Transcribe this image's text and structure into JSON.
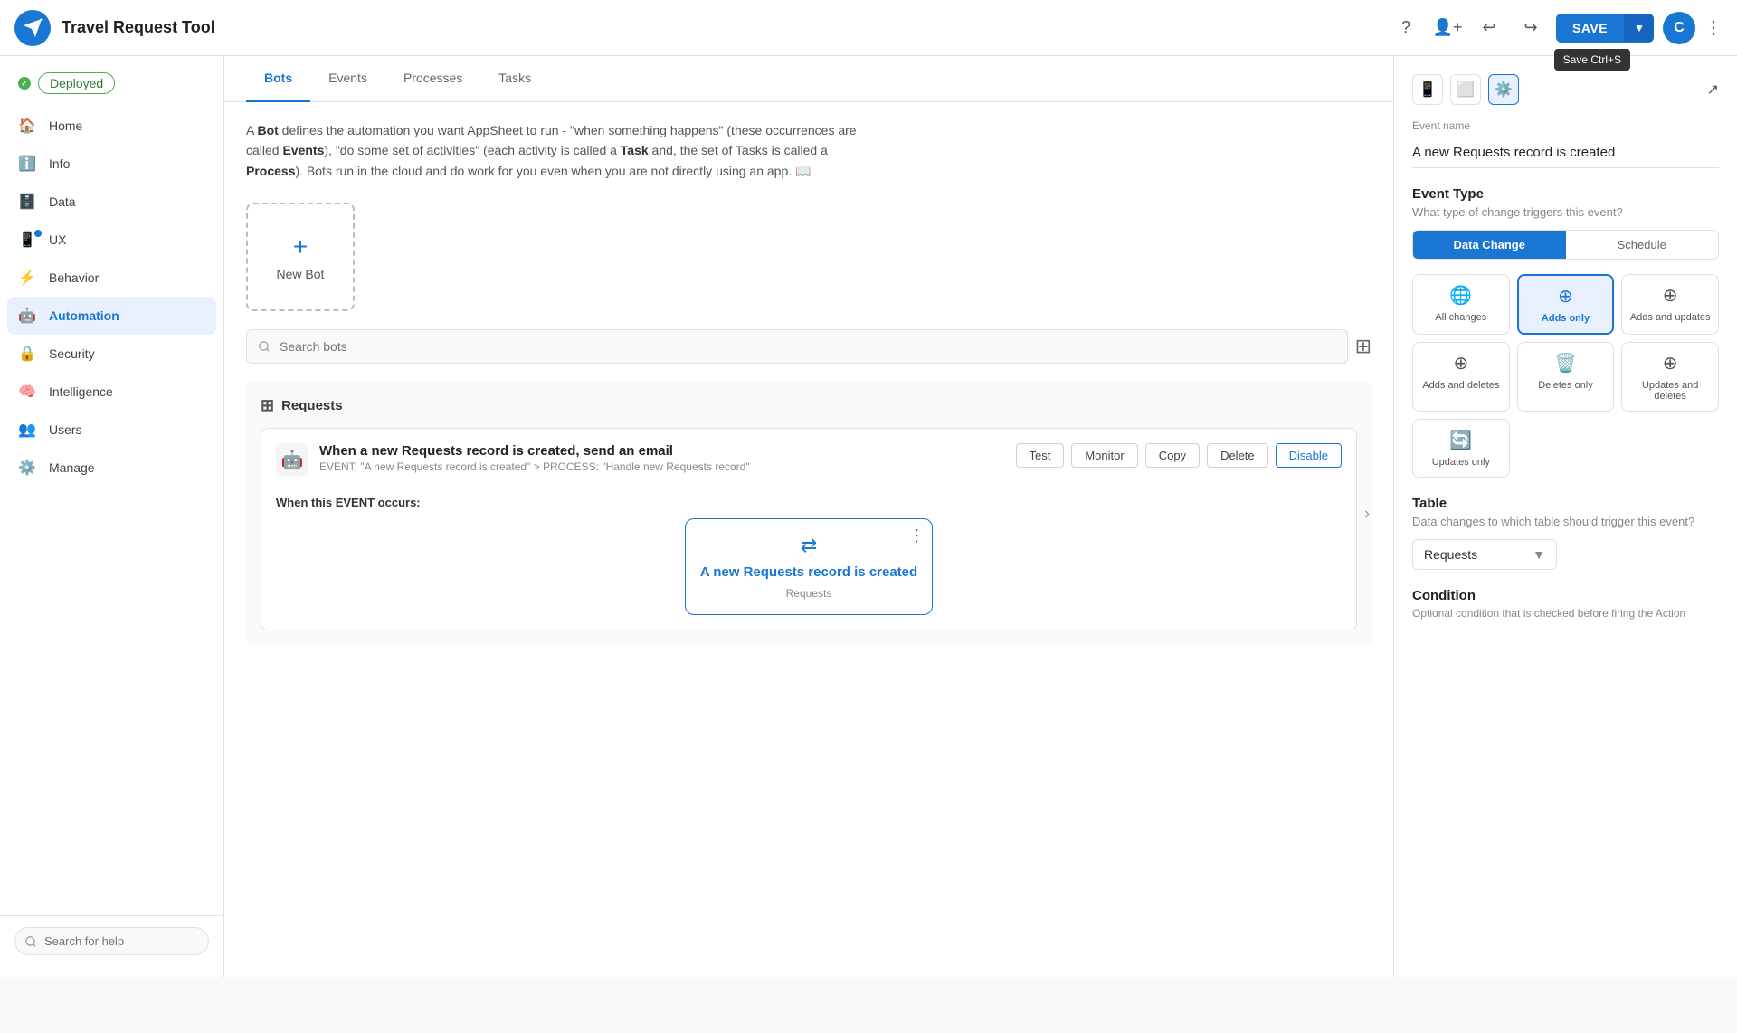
{
  "app": {
    "title": "Travel Request Tool",
    "save_label": "SAVE",
    "save_shortcut": "Save Ctrl+S"
  },
  "topbar": {
    "avatar_letter": "C"
  },
  "sidebar": {
    "status": "Deployed",
    "items": [
      {
        "id": "home",
        "label": "Home",
        "icon": "🏠"
      },
      {
        "id": "info",
        "label": "Info",
        "icon": "ℹ"
      },
      {
        "id": "data",
        "label": "Data",
        "icon": "🗄"
      },
      {
        "id": "ux",
        "label": "UX",
        "icon": "📱",
        "dot": true
      },
      {
        "id": "behavior",
        "label": "Behavior",
        "icon": "⚡"
      },
      {
        "id": "automation",
        "label": "Automation",
        "icon": "🤖",
        "active": true
      },
      {
        "id": "security",
        "label": "Security",
        "icon": "🔒"
      },
      {
        "id": "intelligence",
        "label": "Intelligence",
        "icon": "🧠"
      },
      {
        "id": "users",
        "label": "Users",
        "icon": "👥"
      },
      {
        "id": "manage",
        "label": "Manage",
        "icon": "⚙"
      }
    ],
    "search_placeholder": "Search for help"
  },
  "tabs": [
    {
      "id": "bots",
      "label": "Bots",
      "active": true
    },
    {
      "id": "events",
      "label": "Events"
    },
    {
      "id": "processes",
      "label": "Processes"
    },
    {
      "id": "tasks",
      "label": "Tasks"
    }
  ],
  "description": "A Bot defines the automation you want AppSheet to run - \"when something happens\" (these occurrences are called Events), \"do some set of activities\" (each activity is called a Task and, the set of Tasks is called a Process). Bots run in the cloud and do work for you even when you are not directly using an app.",
  "new_bot_label": "New Bot",
  "search_bots_placeholder": "Search bots",
  "bot_section": {
    "title": "Requests",
    "bot": {
      "title": "When a new Requests record is created, send an email",
      "event_desc": "EVENT: \"A new Requests record is created\" > PROCESS: \"Handle new Requests record\"",
      "actions": [
        "Test",
        "Monitor",
        "Copy",
        "Delete",
        "Disable"
      ],
      "event_label": "When this EVENT occurs:",
      "event_card": {
        "title": "A new Requests record is created",
        "subtitle": "Requests"
      }
    }
  },
  "right_panel": {
    "event_name_label": "Event name",
    "event_name_value": "A new Requests record is created",
    "event_type_title": "Event Type",
    "event_type_subtitle": "What type of change triggers this event?",
    "event_type_tabs": [
      {
        "id": "data_change",
        "label": "Data Change",
        "active": true
      },
      {
        "id": "schedule",
        "label": "Schedule"
      }
    ],
    "change_types": [
      {
        "id": "all_changes",
        "label": "All changes",
        "icon": "🌐"
      },
      {
        "id": "adds_only",
        "label": "Adds only",
        "icon": "⊕",
        "active": true
      },
      {
        "id": "adds_updates",
        "label": "Adds and updates",
        "icon": "⊕"
      },
      {
        "id": "adds_deletes",
        "label": "Adds and deletes",
        "icon": "⊕"
      },
      {
        "id": "deletes_only",
        "label": "Deletes only",
        "icon": "🗑"
      },
      {
        "id": "updates_deletes",
        "label": "Updates and deletes",
        "icon": "⊕"
      },
      {
        "id": "updates_only",
        "label": "Updates only",
        "icon": "🔄"
      }
    ],
    "table_title": "Table",
    "table_subtitle": "Data changes to which table should trigger this event?",
    "table_value": "Requests",
    "condition_title": "Condition",
    "condition_desc": "Optional condition that is checked before firing the Action"
  }
}
